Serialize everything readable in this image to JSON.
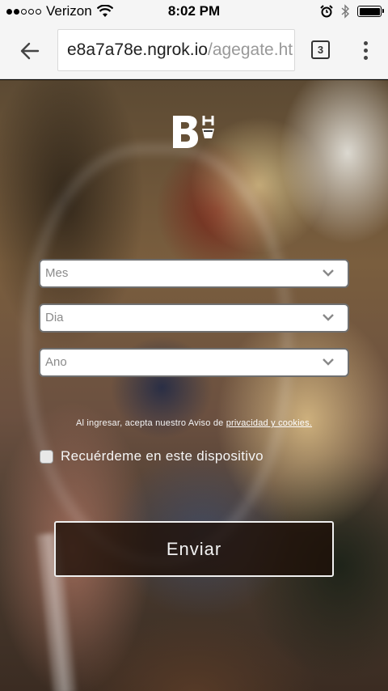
{
  "status_bar": {
    "carrier": "Verizon",
    "time": "8:02 PM",
    "signal_bars_filled": 2,
    "signal_bars_total": 5,
    "battery_level": 1.0
  },
  "browser": {
    "url_host": "e8a7a78e.ngrok.io",
    "url_path": "/agegate.ht",
    "tab_count": "3"
  },
  "form": {
    "month_placeholder": "Mes",
    "day_placeholder": "Dia",
    "year_placeholder": "Ano",
    "consent_prefix": "Al ingresar, acepta nuestro Aviso de",
    "consent_link": "privacidad y cookies.",
    "remember_label": "Recuérdeme en este dispositivo",
    "remember_checked": false,
    "submit_label": "Enviar"
  },
  "brand": {
    "logo_letters": "BH"
  },
  "colors": {
    "chrome_background": "#f5f5f5",
    "field_border": "#6f6f6f",
    "button_border": "#f0f0f0"
  }
}
